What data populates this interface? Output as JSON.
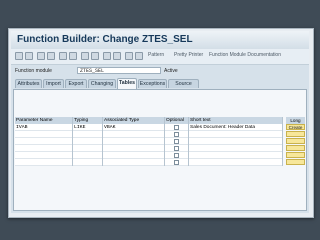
{
  "title": "Function Builder: Change ZTES_SEL",
  "toolbar": {
    "pattern": "Pattern",
    "pretty_printer": "Pretty Printer",
    "documentation": "Function Module Documentation"
  },
  "function_module": {
    "label": "Function module",
    "value": "ZTES_SEL",
    "status": "Active"
  },
  "tabs": [
    "Attributes",
    "Import",
    "Export",
    "Changing",
    "Tables",
    "Exceptions",
    "Source code"
  ],
  "active_tab": "Tables",
  "table": {
    "headers": [
      "Parameter Name",
      "Typing",
      "Associated Type",
      "Optional",
      "Short text",
      "Long Text"
    ],
    "rows": [
      {
        "name": "IVAB",
        "typing": "LIKE",
        "type": "VBAK",
        "short": "Sales Document: Header Data",
        "long": "Create"
      },
      {
        "name": "",
        "typing": "",
        "type": "",
        "short": "",
        "long": ""
      },
      {
        "name": "",
        "typing": "",
        "type": "",
        "short": "",
        "long": ""
      },
      {
        "name": "",
        "typing": "",
        "type": "",
        "short": "",
        "long": ""
      },
      {
        "name": "",
        "typing": "",
        "type": "",
        "short": "",
        "long": ""
      },
      {
        "name": "",
        "typing": "",
        "type": "",
        "short": "",
        "long": ""
      }
    ]
  }
}
